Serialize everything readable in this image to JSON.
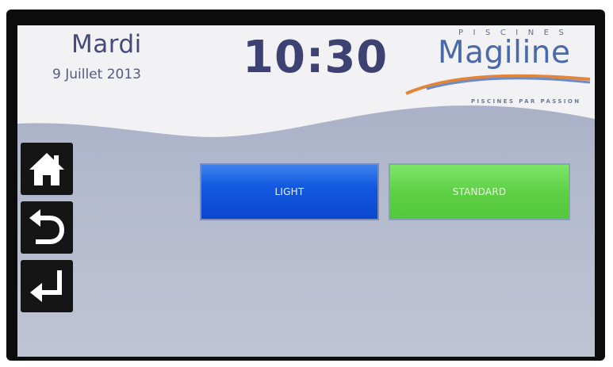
{
  "header": {
    "day": "Mardi",
    "date": "9 Juillet 2013",
    "time": "10:30"
  },
  "logo": {
    "top_text": "PISCINES",
    "brand": "Magiline",
    "tagline": "PISCINES PAR PASSION"
  },
  "nav": {
    "home_icon": "home-icon",
    "back_icon": "undo-arrow-icon",
    "enter_icon": "enter-return-icon"
  },
  "modes": {
    "light_label": "LIGHT",
    "standard_label": "STANDARD"
  },
  "colors": {
    "light_button": "#1359e0",
    "standard_button": "#5fd046",
    "background": "#b3b9cd",
    "header": "#f3f3f6",
    "nav_button": "#151515"
  }
}
